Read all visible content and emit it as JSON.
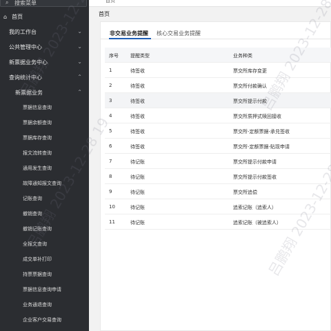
{
  "sidebar": {
    "search_placeholder": "搜索菜单",
    "home_label": "首页",
    "items": [
      {
        "label": "我的工作台",
        "chev": "⌄"
      },
      {
        "label": "公共管理中心",
        "chev": "⌄"
      },
      {
        "label": "新票据业务中心",
        "chev": "⌄"
      },
      {
        "label": "查询统计中心",
        "chev": "⌃"
      }
    ],
    "group": {
      "label": "新票据业务",
      "chev": "⌃"
    },
    "subitems": [
      "票据信息查询",
      "票据余额查询",
      "票据库存查询",
      "报文流转查询",
      "通用发生查询",
      "故障通知报文查询",
      "记账查询",
      "撤销查询",
      "撤销记账查询",
      "全报文查询",
      "成交单补打印",
      "持票票据查询",
      "票据信息查询申请",
      "业务通退查询",
      "企业客户交易查询"
    ]
  },
  "topbar": {
    "crumb": "首页"
  },
  "page_title": "首页",
  "tabs": [
    {
      "label": "非交易业务提醒",
      "active": true
    },
    {
      "label": "核心交易业务提醒",
      "active": false
    }
  ],
  "table": {
    "headers": [
      "序号",
      "提醒类型",
      "业务种类"
    ],
    "rows": [
      [
        "1",
        "待签收",
        "票交所库存变更"
      ],
      [
        "2",
        "待签收",
        "票交所付款确认"
      ],
      [
        "3",
        "待签收",
        "票交所提示付款"
      ],
      [
        "4",
        "待签收",
        "票交所质押式赎回接收"
      ],
      [
        "5",
        "待签收",
        "票交所-定额票据-承兑签收"
      ],
      [
        "6",
        "待签收",
        "票交所-定额票据-贴现申请"
      ],
      [
        "7",
        "待记账",
        "票交所提示付款申请"
      ],
      [
        "8",
        "待记账",
        "票交所提示付款签收"
      ],
      [
        "9",
        "待记账",
        "票交所追偿"
      ],
      [
        "10",
        "待记账",
        "追索记账（追索人）"
      ],
      [
        "11",
        "待记账",
        "追索记账（被追索人）"
      ]
    ]
  },
  "watermarks": [
    "吕鹏翔 2023-12-28 19",
    "吕鹏翔 2023-12-28 19",
    "吕鹏翔 2023-12-28 19",
    "吕鹏翔 2023-12-28 19"
  ],
  "colors": {
    "sidebar_bg": "#2b2d31",
    "accent": "#1e5eb5"
  }
}
